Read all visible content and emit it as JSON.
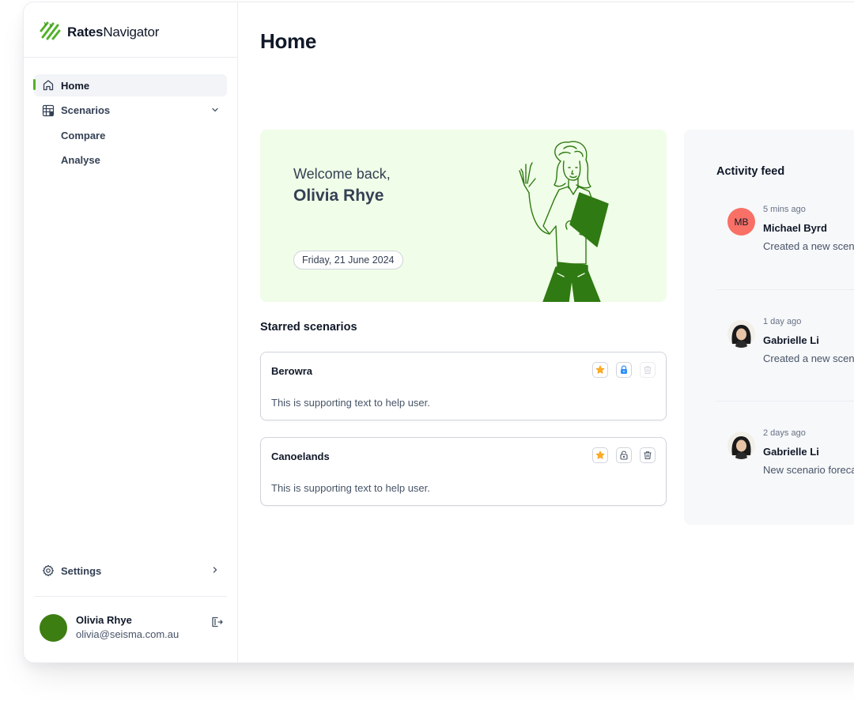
{
  "brand": {
    "name_bold": "Rates",
    "name_rest": "Navigator",
    "accent": "#53b12b"
  },
  "sidebar": {
    "items": [
      {
        "label": "Home",
        "icon": "home-icon",
        "active": true
      },
      {
        "label": "Scenarios",
        "icon": "table-grid-icon",
        "expandable": true
      },
      {
        "label": "Compare"
      },
      {
        "label": "Analyse"
      }
    ],
    "settings_label": "Settings",
    "user": {
      "name": "Olivia Rhye",
      "email": "olivia@seisma.com.au"
    }
  },
  "main": {
    "title": "Home",
    "welcome": {
      "greeting": "Welcome back,",
      "name": "Olivia Rhye",
      "date": "Friday, 21 June 2024"
    },
    "starred": {
      "title": "Starred scenarios",
      "scenarios": [
        {
          "name": "Berowra",
          "text": "This is supporting text to help user.",
          "locked": true
        },
        {
          "name": "Canoelands",
          "text": "This is supporting text to help user.",
          "locked": false
        }
      ]
    },
    "activity": {
      "title": "Activity feed",
      "items": [
        {
          "initials": "MB",
          "time": "5 mins ago",
          "name": "Michael Byrd",
          "desc": "Created a new scen"
        },
        {
          "initials": "",
          "time": "1 day ago",
          "name": "Gabrielle Li",
          "desc": "Created a new scen"
        },
        {
          "initials": "",
          "time": "2 days ago",
          "name": "Gabrielle Li",
          "desc": "New scenario foreca"
        }
      ]
    }
  }
}
